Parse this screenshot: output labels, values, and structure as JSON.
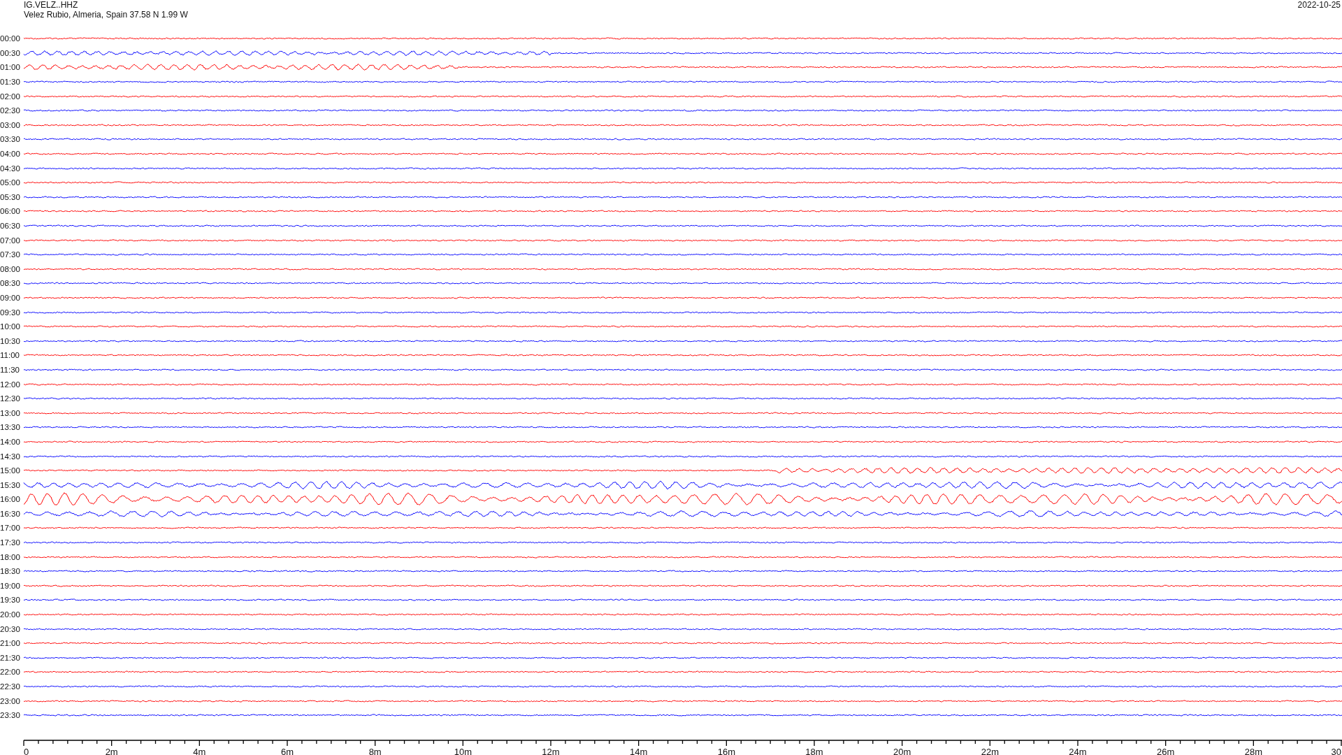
{
  "header": {
    "station": "IG.VELZ..HHZ",
    "location": "Velez Rubio, Almeria, Spain  37.58 N 1.99 W",
    "date": "2022-10-25"
  },
  "rows": [
    {
      "time": "00:00",
      "color": "#ff0000"
    },
    {
      "time": "00:30",
      "color": "#0000ff"
    },
    {
      "time": "01:00",
      "color": "#ff0000"
    },
    {
      "time": "01:30",
      "color": "#0000ff"
    },
    {
      "time": "02:00",
      "color": "#ff0000"
    },
    {
      "time": "02:30",
      "color": "#0000ff"
    },
    {
      "time": "03:00",
      "color": "#ff0000"
    },
    {
      "time": "03:30",
      "color": "#0000ff"
    },
    {
      "time": "04:00",
      "color": "#ff0000"
    },
    {
      "time": "04:30",
      "color": "#0000ff"
    },
    {
      "time": "05:00",
      "color": "#ff0000"
    },
    {
      "time": "05:30",
      "color": "#0000ff"
    },
    {
      "time": "06:00",
      "color": "#ff0000"
    },
    {
      "time": "06:30",
      "color": "#0000ff"
    },
    {
      "time": "07:00",
      "color": "#ff0000"
    },
    {
      "time": "07:30",
      "color": "#0000ff"
    },
    {
      "time": "08:00",
      "color": "#ff0000"
    },
    {
      "time": "08:30",
      "color": "#0000ff"
    },
    {
      "time": "09:00",
      "color": "#ff0000"
    },
    {
      "time": "09:30",
      "color": "#0000ff"
    },
    {
      "time": "10:00",
      "color": "#ff0000"
    },
    {
      "time": "10:30",
      "color": "#0000ff"
    },
    {
      "time": "11:00",
      "color": "#ff0000"
    },
    {
      "time": "11:30",
      "color": "#0000ff"
    },
    {
      "time": "12:00",
      "color": "#ff0000"
    },
    {
      "time": "12:30",
      "color": "#0000ff"
    },
    {
      "time": "13:00",
      "color": "#ff0000"
    },
    {
      "time": "13:30",
      "color": "#0000ff"
    },
    {
      "time": "14:00",
      "color": "#ff0000"
    },
    {
      "time": "14:30",
      "color": "#0000ff"
    },
    {
      "time": "15:00",
      "color": "#ff0000"
    },
    {
      "time": "15:30",
      "color": "#0000ff"
    },
    {
      "time": "16:00",
      "color": "#ff0000"
    },
    {
      "time": "16:30",
      "color": "#0000ff"
    },
    {
      "time": "17:00",
      "color": "#ff0000"
    },
    {
      "time": "17:30",
      "color": "#0000ff"
    },
    {
      "time": "18:00",
      "color": "#ff0000"
    },
    {
      "time": "18:30",
      "color": "#0000ff"
    },
    {
      "time": "19:00",
      "color": "#ff0000"
    },
    {
      "time": "19:30",
      "color": "#0000ff"
    },
    {
      "time": "20:00",
      "color": "#ff0000"
    },
    {
      "time": "20:30",
      "color": "#0000ff"
    },
    {
      "time": "21:00",
      "color": "#ff0000"
    },
    {
      "time": "21:30",
      "color": "#0000ff"
    },
    {
      "time": "22:00",
      "color": "#ff0000"
    },
    {
      "time": "22:30",
      "color": "#0000ff"
    },
    {
      "time": "23:00",
      "color": "#ff0000"
    },
    {
      "time": "23:30",
      "color": "#0000ff"
    }
  ],
  "axis": {
    "tick_labels": [
      "0",
      "2m",
      "4m",
      "6m",
      "8m",
      "10m",
      "12m",
      "14m",
      "16m",
      "18m",
      "20m",
      "22m",
      "24m",
      "26m",
      "28m",
      "30"
    ]
  }
}
